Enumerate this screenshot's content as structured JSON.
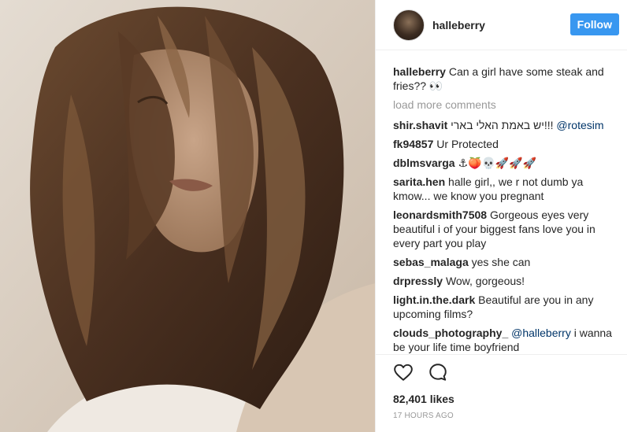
{
  "post": {
    "username": "halleberry",
    "follow_label": "Follow"
  },
  "caption": {
    "username": "halleberry",
    "text": "Can a girl have some steak and fries?? 👀"
  },
  "load_more": "load more comments",
  "comments": [
    {
      "username": "shir.shavit",
      "text": "יש באמת האלי בארי!!!",
      "mention": "@rotesim"
    },
    {
      "username": "fk94857",
      "text": "Ur Protected",
      "mention": ""
    },
    {
      "username": "dblmsvarga",
      "text": "⚓🍑💀🚀🚀🚀",
      "mention": ""
    },
    {
      "username": "sarita.hen",
      "text": "halle girl,, we r not dumb ya kmow... we know you pregnant",
      "mention": ""
    },
    {
      "username": "leonardsmith7508",
      "text": "Gorgeous eyes very beautiful i of your biggest fans love you in every part you play",
      "mention": ""
    },
    {
      "username": "sebas_malaga",
      "text": "yes she can",
      "mention": ""
    },
    {
      "username": "drpressly",
      "text": "Wow, gorgeous!",
      "mention": ""
    },
    {
      "username": "light.in.the.dark",
      "text": "Beautiful are you in any upcoming films?",
      "mention": ""
    },
    {
      "username": "clouds_photography_",
      "text": "i wanna be your life time boyfriend",
      "mention": "@halleberry"
    }
  ],
  "likes": "82,401 likes",
  "timestamp": "17 HOURS AGO",
  "icons": {
    "like": "heart-icon",
    "comment": "comment-icon"
  },
  "colors": {
    "follow": "#3897f0",
    "mention": "#003569",
    "muted": "#999999"
  }
}
